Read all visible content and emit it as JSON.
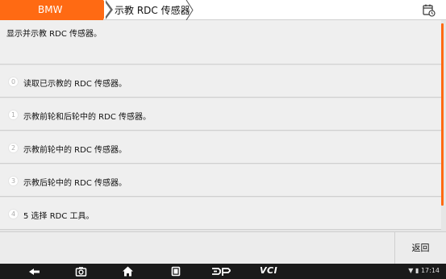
{
  "breadcrumb": {
    "home": "BMW",
    "current": "示教 RDC 传感器"
  },
  "topbar": {
    "right_icon": "calendar-clock-icon"
  },
  "description": "显示并示教 RDC 传感器。",
  "menu": {
    "items": [
      {
        "index": "0",
        "label": "读取已示教的 RDC 传感器。"
      },
      {
        "index": "1",
        "label": "示教前轮和后轮中的 RDC 传感器。"
      },
      {
        "index": "2",
        "label": "示教前轮中的 RDC 传感器。"
      },
      {
        "index": "3",
        "label": "示教后轮中的 RDC 传感器。"
      },
      {
        "index": "4",
        "label": "5 选择 RDC 工具。"
      }
    ]
  },
  "buttons": {
    "back": "返回"
  },
  "navbar": {
    "icons": [
      "back-arrow-icon",
      "camera-icon",
      "home-icon",
      "recent-apps-icon",
      "dp-logo-icon",
      "vci-icon"
    ],
    "vci_label": "VCI",
    "time": "17:14"
  },
  "colors": {
    "accent": "#ff6a13",
    "background": "#e6e6e6",
    "navbar": "#1a1a1a"
  }
}
